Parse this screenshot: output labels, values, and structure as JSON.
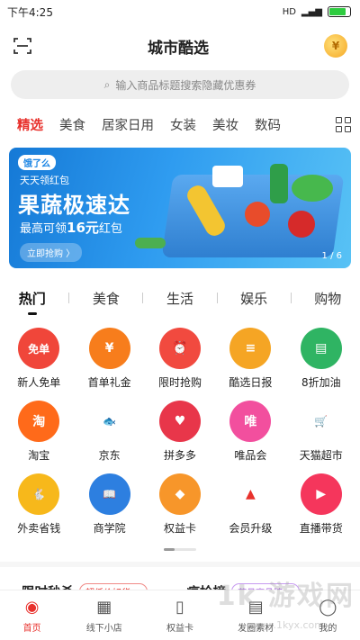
{
  "status_bar": {
    "time": "下午4:25",
    "signal": "HD"
  },
  "header": {
    "title": "城市酷选"
  },
  "search": {
    "placeholder": "输入商品标题搜索隐藏优惠券"
  },
  "categories": [
    "精选",
    "美食",
    "居家日用",
    "女装",
    "美妆",
    "数码"
  ],
  "banner": {
    "logo": "饿了么",
    "subtitle": "天天领红包",
    "headline": "果蔬极速达",
    "desc_prefix": "最高可领",
    "desc_amount": "16元",
    "desc_suffix": "红包",
    "cta": "立即抢购 〉",
    "page": "1 / 6"
  },
  "section_tabs": [
    "热门",
    "美食",
    "生活",
    "娱乐",
    "购物"
  ],
  "icons": [
    {
      "label": "新人免单",
      "glyph": "免单",
      "color": "#f0463a",
      "icon": "free-order-icon"
    },
    {
      "label": "首单礼金",
      "glyph": "¥",
      "color": "#f77d1c",
      "icon": "gift-money-icon"
    },
    {
      "label": "限时抢购",
      "glyph": "⏰",
      "color": "#f14a3f",
      "icon": "alarm-clock-icon"
    },
    {
      "label": "酷选日报",
      "glyph": "≡",
      "color": "#f5a524",
      "icon": "daily-report-icon"
    },
    {
      "label": "8折加油",
      "glyph": "▤",
      "color": "#2fb463",
      "icon": "fuel-card-icon"
    },
    {
      "label": "淘宝",
      "glyph": "淘",
      "color": "#ff6a1a",
      "icon": "taobao-icon"
    },
    {
      "label": "京东",
      "glyph": "🐟",
      "color": "#ffffff",
      "icon": "jd-icon"
    },
    {
      "label": "拼多多",
      "glyph": "♥",
      "color": "#e8364a",
      "icon": "pinduoduo-icon"
    },
    {
      "label": "唯品会",
      "glyph": "唯",
      "color": "#f24f9e",
      "icon": "vip-icon"
    },
    {
      "label": "天猫超市",
      "glyph": "🛒",
      "color": "#ffffff",
      "icon": "tmall-market-icon"
    },
    {
      "label": "外卖省钱",
      "glyph": "🐇",
      "color": "#f7b81b",
      "icon": "takeout-icon"
    },
    {
      "label": "商学院",
      "glyph": "📖",
      "color": "#2d7fe0",
      "icon": "business-school-icon"
    },
    {
      "label": "权益卡",
      "glyph": "◆",
      "color": "#f7962a",
      "icon": "benefit-card-icon"
    },
    {
      "label": "会员升级",
      "glyph": "▲",
      "color": "#ffffff",
      "icon": "member-upgrade-icon"
    },
    {
      "label": "直播带货",
      "glyph": "▶",
      "color": "#f5365c",
      "icon": "live-stream-icon"
    }
  ],
  "flash": {
    "title1": "限时秒杀",
    "pill1": "超低价好货 >",
    "title2": "疯抢榜",
    "pill2": "蓝月亮品牌 >"
  },
  "nav": [
    {
      "label": "首页",
      "icon": "home-icon",
      "active": true
    },
    {
      "label": "线下小店",
      "icon": "store-grid-icon",
      "active": false
    },
    {
      "label": "权益卡",
      "icon": "card-icon",
      "active": false
    },
    {
      "label": "发圈素材",
      "icon": "material-icon",
      "active": false
    },
    {
      "label": "我的",
      "icon": "profile-icon",
      "active": false
    }
  ],
  "watermark": {
    "main": "1k 游戏网",
    "url": "www.1kyx.com"
  }
}
